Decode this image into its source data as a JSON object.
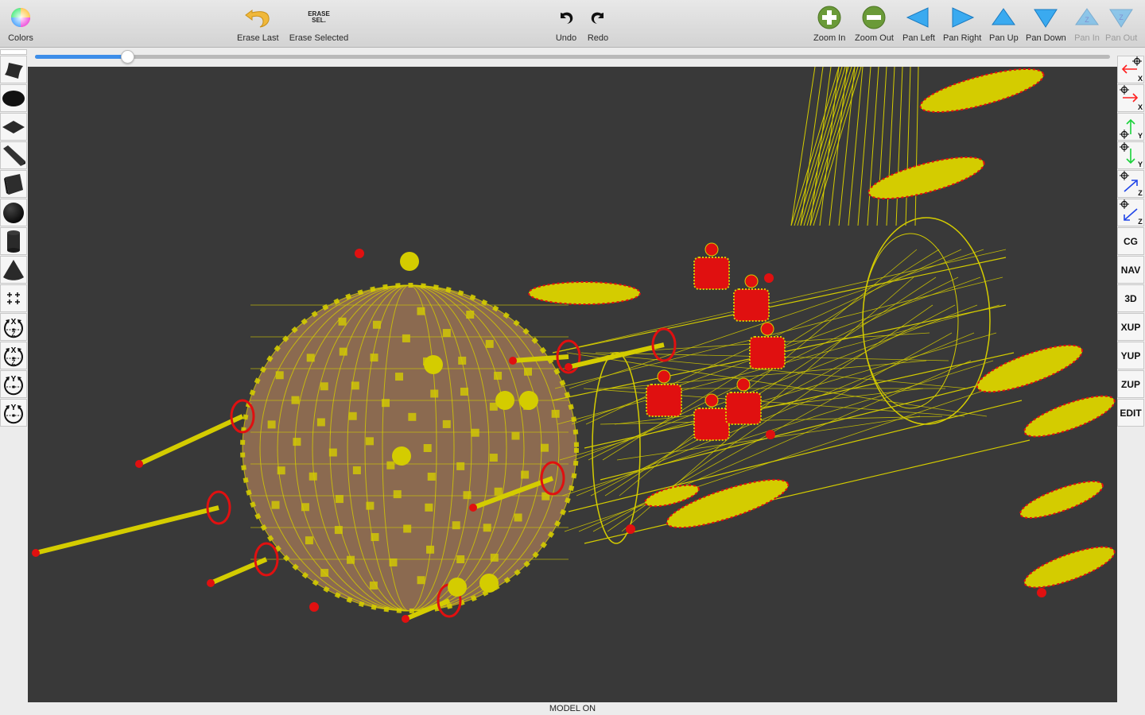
{
  "toolbar": {
    "colors": {
      "label": "Colors",
      "icon": "color-wheel-icon"
    },
    "erase_last": {
      "label": "Erase Last",
      "icon": "undo-arrow-icon"
    },
    "erase_selected": {
      "label": "Erase Selected",
      "icon_text_line1": "ERASE",
      "icon_text_line2": "SEL."
    },
    "undo": {
      "label": "Undo",
      "icon": "undo-icon"
    },
    "redo": {
      "label": "Redo",
      "icon": "redo-icon"
    },
    "zoom_in": {
      "label": "Zoom In",
      "icon": "plus-circle-icon"
    },
    "zoom_out": {
      "label": "Zoom Out",
      "icon": "minus-circle-icon"
    },
    "pan_left": {
      "label": "Pan Left",
      "icon": "triangle-left-icon"
    },
    "pan_right": {
      "label": "Pan Right",
      "icon": "triangle-right-icon"
    },
    "pan_up": {
      "label": "Pan Up",
      "icon": "triangle-up-icon"
    },
    "pan_down": {
      "label": "Pan Down",
      "icon": "triangle-down-icon"
    },
    "pan_in": {
      "label": "Pan In",
      "icon": "triangle-up-z-icon",
      "disabled": true,
      "glyph": "Z"
    },
    "pan_out": {
      "label": "Pan Out",
      "icon": "triangle-down-z-icon",
      "disabled": true,
      "glyph": "Z"
    }
  },
  "slider": {
    "value_fraction": 0.086,
    "accent": "#3d8ee9"
  },
  "left_tools": [
    {
      "name": "surface-tool",
      "icon": "curved-surface-icon"
    },
    {
      "name": "ellipse-tool",
      "icon": "ellipse-icon"
    },
    {
      "name": "plane-tool",
      "icon": "diamond-plane-icon"
    },
    {
      "name": "wedge-tool",
      "icon": "wedge-icon"
    },
    {
      "name": "box-tool",
      "icon": "cube-icon"
    },
    {
      "name": "sphere-tool",
      "icon": "sphere-icon"
    },
    {
      "name": "cylinder-tool",
      "icon": "cylinder-icon"
    },
    {
      "name": "cone-tool",
      "icon": "cone-icon"
    },
    {
      "name": "points-tool",
      "glyph": "++\n++"
    },
    {
      "name": "rotate-xz-cw",
      "axis_top": "X",
      "axis_bottom": "Z"
    },
    {
      "name": "rotate-xz-ccw",
      "axis_top": "X",
      "axis_bottom": "Z"
    },
    {
      "name": "rotate-y-cw",
      "axis_top": "Y"
    },
    {
      "name": "rotate-y-ccw",
      "axis_top": "Y"
    }
  ],
  "right_tools": {
    "axis_buttons": [
      {
        "name": "move-neg-x",
        "axis": "X",
        "color": "#ff2020",
        "dir": "left"
      },
      {
        "name": "move-pos-x",
        "axis": "X",
        "color": "#ff2020",
        "dir": "right"
      },
      {
        "name": "move-pos-y",
        "axis": "Y",
        "color": "#19d23a",
        "dir": "up"
      },
      {
        "name": "move-neg-y",
        "axis": "Y",
        "color": "#19d23a",
        "dir": "down"
      },
      {
        "name": "move-pos-z",
        "axis": "Z",
        "color": "#2146e8",
        "dir": "upright"
      },
      {
        "name": "move-neg-z",
        "axis": "Z",
        "color": "#2146e8",
        "dir": "downleft"
      }
    ],
    "text_buttons": [
      "CG",
      "NAV",
      "3D",
      "XUP",
      "YUP",
      "ZUP",
      "EDIT"
    ]
  },
  "viewport": {
    "background": "#393939",
    "wire_color": "#d4cc00",
    "vertex_color": "#e01010",
    "hull_color": "#9a7355"
  },
  "status": {
    "text": "MODEL ON"
  }
}
